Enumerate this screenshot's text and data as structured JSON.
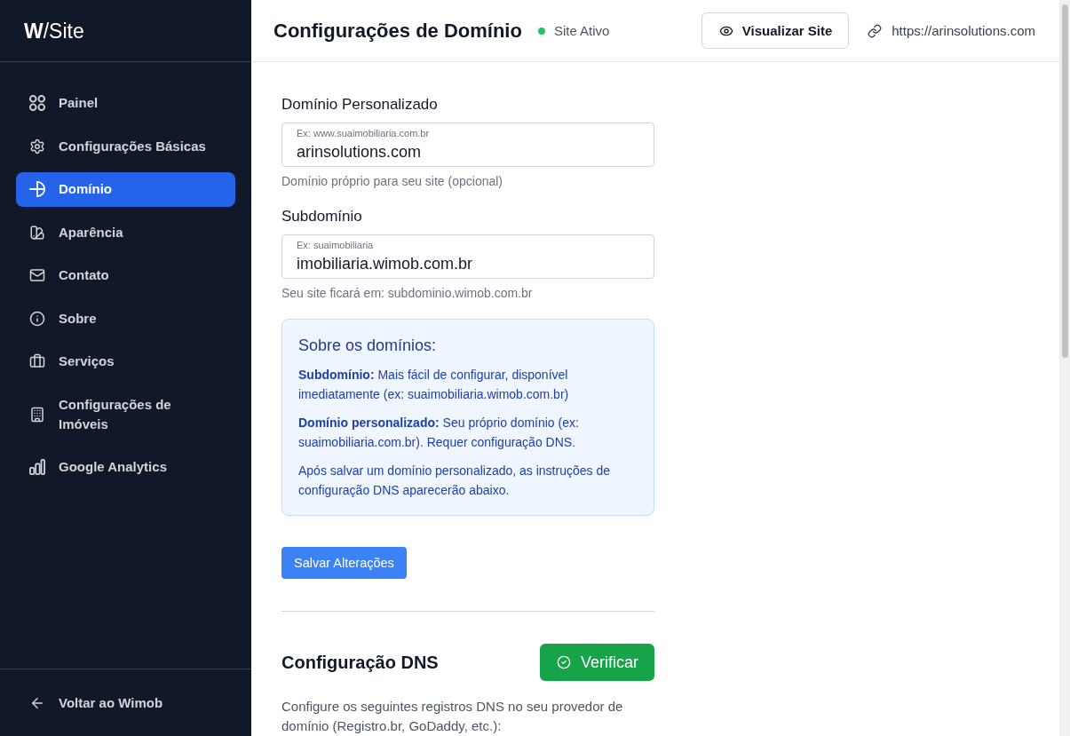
{
  "sidebar": {
    "logo": "**W**/Site",
    "items": [
      {
        "label": "Painel",
        "selected": false
      },
      {
        "label": "Configurações Básicas",
        "selected": false
      },
      {
        "label": "Domínio",
        "selected": true
      },
      {
        "label": "Aparência",
        "selected": false
      },
      {
        "label": "Contato",
        "selected": false
      },
      {
        "label": "Sobre",
        "selected": false
      },
      {
        "label": "Serviços",
        "selected": false
      },
      {
        "label": "Configurações de Imóveis",
        "selected": false
      },
      {
        "label": "Google Analytics",
        "selected": false
      }
    ],
    "back_link": "Voltar ao Wimob"
  },
  "header": {
    "title": "Configurações de Domínio",
    "status": {
      "label": "Site Ativo",
      "active": true
    },
    "view_button": "Visualizar Site",
    "site_link": "https://arinsolutions.com"
  },
  "form": {
    "fields": [
      {
        "label": "Domínio Personalizado",
        "hint": "Ex: www.suaimobiliaria.com.br",
        "value": "arinsolutions.com",
        "help": "Domínio próprio para seu site (opcional)"
      },
      {
        "label": "Subdomínio",
        "hint": "Ex: suaimobiliaria",
        "value": "imobiliaria.wimob.com.br",
        "help": "Seu site ficará em: subdominio.wimob.com.br"
      }
    ],
    "info_box": {
      "title": "Sobre os domínios:",
      "definitions": [
        "**Subdomínio:** Mais fácil de configurar, disponível imediatamente (ex: suaimobiliaria.wimob.com.br)",
        "**Domínio personalizado:** Seu próprio domínio (ex: suaimobiliaria.com.br). Requer configuração DNS."
      ],
      "note": "Após salvar um domínio personalizado, as instruções de configuração DNS aparecerão abaixo."
    },
    "save_button": "Salvar Alterações"
  },
  "dns": {
    "title": "Configuração DNS",
    "verify_button": "Verificar",
    "description": "Configure os seguintes registros DNS no seu provedor de domínio (Registro.br, GoDaddy, etc.):"
  }
}
